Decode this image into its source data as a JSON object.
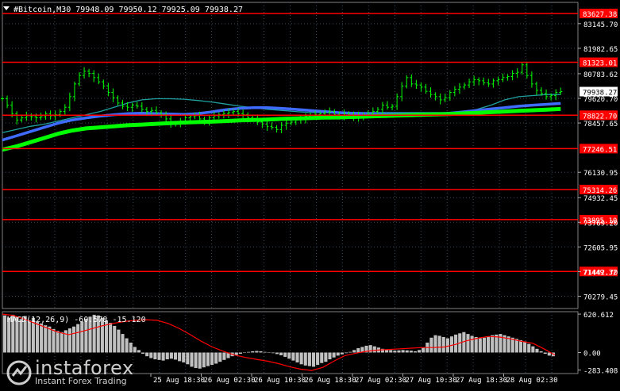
{
  "header": {
    "symbol_line": "#Bitcoin,M30  79948.09 79950.12 79925.09 79938.27",
    "indicator_line": "MACD(12,26,9) -60.578 -15.120"
  },
  "watermark": {
    "brand": "instaforex",
    "tagline": "Instant Forex Trading"
  },
  "colors": {
    "background": "#000000",
    "grid": "#3a4a5a",
    "candles": "#00ff00",
    "level_lines": "#ff0000",
    "ma_fast": "#1fa0a0",
    "ma_mid": "#3f6bff",
    "ma_slow": "#00ff00",
    "macd_hist": "#c0c0c0",
    "macd_signal": "#ff0000",
    "text": "#ffffff"
  },
  "chart_data": [
    {
      "type": "line",
      "title": "#Bitcoin,M30",
      "ylim": [
        69700,
        84150
      ],
      "y_tick_labels": [
        "83145.70",
        "81982.65",
        "80783.62",
        "79620.70",
        "78457.65",
        "76130.95",
        "74932.45",
        "73769.20",
        "72605.95",
        "71442.70",
        "70279.45"
      ],
      "x_tick_labels": [
        "25 Aug 18:30",
        "26 Aug 02:30",
        "26 Aug 10:30",
        "26 Aug 18:30",
        "27 Aug 02:30",
        "27 Aug 10:30",
        "27 Aug 18:30",
        "28 Aug 02:30"
      ],
      "horizontal_levels": [
        {
          "label": "83627.38",
          "value": 83627.38
        },
        {
          "label": "81323.01",
          "value": 81323.01
        },
        {
          "label": "78822.70",
          "value": 78822.7
        },
        {
          "label": "77246.51",
          "value": 77246.51
        },
        {
          "label": "75314.26",
          "value": 75314.26
        },
        {
          "label": "73895.10",
          "value": 73895.1
        },
        {
          "label": "71449.32",
          "value": 71449.32
        }
      ],
      "current_price": {
        "label": "79938.27",
        "value": 79938.27
      },
      "series": [
        {
          "role": "price",
          "values": [
            79600,
            79300,
            78900,
            78600,
            78700,
            78800,
            78750,
            78700,
            78750,
            78900,
            78800,
            78850,
            79000,
            79200,
            79700,
            80300,
            80700,
            80900,
            80800,
            80600,
            80400,
            80200,
            79900,
            79650,
            79400,
            79250,
            79200,
            79300,
            79250,
            79100,
            79000,
            79050,
            78950,
            78850,
            78650,
            78450,
            78400,
            78550,
            78700,
            78750,
            78800,
            78650,
            78550,
            78700,
            78800,
            78850,
            78900,
            78950,
            79000,
            78900,
            78850,
            78700,
            78650,
            78500,
            78400,
            78300,
            78250,
            78150,
            78350,
            78450,
            78500,
            78600,
            78650,
            78800,
            78750,
            78850,
            78900,
            78950,
            79000,
            78850,
            78800,
            78900,
            78850,
            78700,
            78800,
            78850,
            78900,
            79000,
            79100,
            79300,
            79200,
            79250,
            79700,
            80200,
            80600,
            80300,
            80250,
            80150,
            79950,
            79800,
            79700,
            79550,
            79650,
            79900,
            80050,
            80150,
            80250,
            80400,
            80500,
            80450,
            80350,
            80300,
            80450,
            80500,
            80600,
            80650,
            80800,
            80850,
            81200,
            80700,
            80300,
            80000,
            79850,
            79700,
            79750,
            79900,
            79938
          ]
        },
        {
          "role": "ma_fast",
          "values": [
            78000,
            78150,
            78300,
            78400,
            78550,
            78700,
            78850,
            79000,
            79200,
            79400,
            79550,
            79600,
            79600,
            79580,
            79520,
            79450,
            79350,
            79250,
            79180,
            79100,
            79050,
            79000,
            78950,
            78950,
            78950,
            78950,
            78950,
            78950,
            78950,
            78950,
            78950,
            78950,
            78950,
            78980,
            79100,
            79300,
            79550,
            79700,
            79750,
            79800,
            79800
          ]
        },
        {
          "role": "ma_mid",
          "values": [
            77650,
            77850,
            78050,
            78250,
            78450,
            78600,
            78700,
            78780,
            78850,
            78900,
            78920,
            78900,
            78880,
            78860,
            78900,
            78980,
            79080,
            79150,
            79180,
            79180,
            79150,
            79100,
            79050,
            79000,
            78950,
            78920,
            78900,
            78880,
            78870,
            78860,
            78860,
            78880,
            78920,
            78980,
            79050,
            79120,
            79180,
            79250,
            79300,
            79340,
            79380
          ]
        },
        {
          "role": "ma_slow",
          "values": [
            77200,
            77350,
            77550,
            77750,
            77950,
            78100,
            78200,
            78250,
            78300,
            78350,
            78380,
            78420,
            78450,
            78480,
            78500,
            78520,
            78550,
            78580,
            78600,
            78620,
            78650,
            78670,
            78690,
            78710,
            78720,
            78740,
            78760,
            78780,
            78800,
            78820,
            78840,
            78860,
            78880,
            78910,
            78940,
            78970,
            79000,
            79030,
            79060,
            79090,
            79120
          ]
        }
      ]
    },
    {
      "type": "bar",
      "title": "MACD(12,26,9)",
      "ylim": [
        -340,
        660
      ],
      "y_tick_labels": [
        "620.612",
        "0.00",
        "-283.408"
      ],
      "series": [
        {
          "role": "histogram",
          "values": [
            600,
            560,
            610,
            580,
            540,
            590,
            520,
            560,
            500,
            470,
            440,
            420,
            380,
            350,
            330,
            360,
            390,
            420,
            460,
            500,
            540,
            580,
            610,
            600,
            560,
            520,
            480,
            430,
            370,
            300,
            230,
            160,
            90,
            40,
            -20,
            -60,
            -90,
            -110,
            -120,
            -130,
            -110,
            -100,
            -115,
            -140,
            -160,
            -190,
            -230,
            -250,
            -260,
            -240,
            -220,
            -200,
            -180,
            -150,
            -120,
            -90,
            -60,
            -40,
            -20,
            0,
            10,
            20,
            25,
            20,
            10,
            0,
            -10,
            -25,
            -45,
            -70,
            -100,
            -130,
            -160,
            -190,
            -210,
            -220,
            -230,
            -200,
            -170,
            -150,
            -110,
            -80,
            -50,
            -30,
            -10,
            10,
            40,
            70,
            90,
            110,
            120,
            100,
            80,
            60,
            50,
            40,
            30,
            35,
            40,
            35,
            30,
            20,
            40,
            80,
            160,
            240,
            280,
            270,
            250,
            230,
            260,
            290,
            310,
            330,
            300,
            270,
            250,
            230,
            240,
            260,
            280,
            290,
            300,
            280,
            260,
            240,
            220,
            200,
            180,
            140,
            100,
            60,
            20,
            -20,
            -50,
            -60
          ]
        },
        {
          "role": "signal",
          "values": [
            620,
            600,
            540,
            470,
            400,
            330,
            290,
            330,
            380,
            430,
            470,
            500,
            520,
            530,
            520,
            470,
            390,
            290,
            180,
            90,
            20,
            -40,
            -80,
            -110,
            -140,
            -180,
            -230,
            -270,
            -290,
            -240,
            -140,
            -50,
            -10,
            20,
            40,
            50,
            60,
            70,
            80,
            80,
            90,
            130,
            190,
            230,
            260,
            250,
            220,
            180,
            150,
            60,
            -40
          ]
        }
      ]
    }
  ]
}
